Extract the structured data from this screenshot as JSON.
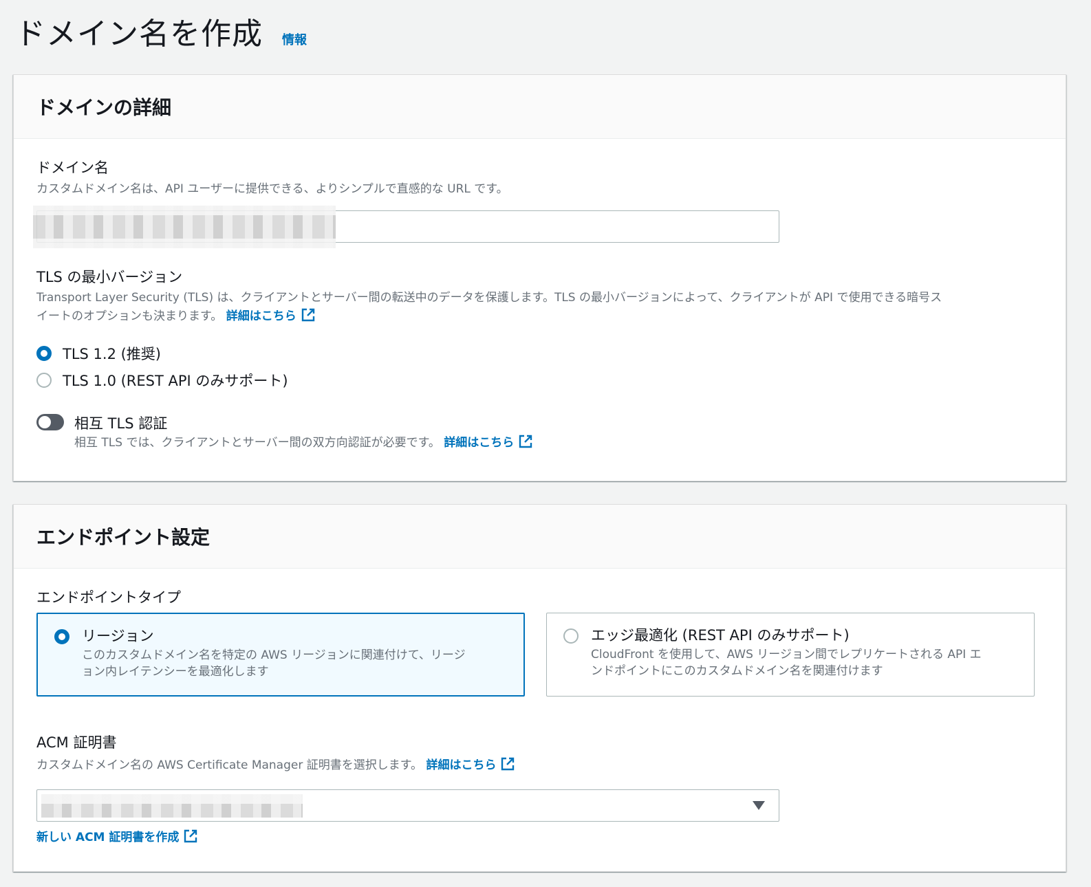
{
  "page": {
    "title": "ドメイン名を作成",
    "info_link": "情報"
  },
  "domain_details": {
    "title": "ドメインの詳細",
    "domain_name": {
      "label": "ドメイン名",
      "description": "カスタムドメイン名は、API ユーザーに提供できる、よりシンプルで直感的な URL です。",
      "value": ""
    },
    "tls": {
      "label": "TLS の最小バージョン",
      "description_line1": "Transport Layer Security (TLS) は、クライアントとサーバー間の転送中のデータを保護します。TLS の最小バージョンによって、クライアントが API で使用できる暗号ス",
      "description_line2": "イートのオプションも決まります。",
      "learn_more": "詳細はこちら",
      "options": [
        {
          "label": "TLS 1.2 (推奨)",
          "selected": true
        },
        {
          "label": "TLS 1.0 (REST API のみサポート)",
          "selected": false
        }
      ]
    },
    "mutual_tls": {
      "label": "相互 TLS 認証",
      "description": "相互 TLS では、クライアントとサーバー間の双方向認証が必要です。",
      "learn_more": "詳細はこちら",
      "enabled": false
    }
  },
  "endpoint": {
    "title": "エンドポイント設定",
    "type_label": "エンドポイントタイプ",
    "tiles": [
      {
        "title": "リージョン",
        "description_line1": "このカスタムドメイン名を特定の AWS リージョンに関連付けて、リージ",
        "description_line2": "ョン内レイテンシーを最適化します",
        "selected": true
      },
      {
        "title": "エッジ最適化 (REST API のみサポート)",
        "description_line1": "CloudFront を使用して、AWS リージョン間でレプリケートされる API エ",
        "description_line2": "ンドポイントにこのカスタムドメイン名を関連付けます",
        "selected": false
      }
    ],
    "acm": {
      "label": "ACM 証明書",
      "description": "カスタムドメイン名の AWS Certificate Manager 証明書を選択します。",
      "learn_more": "詳細はこちら",
      "create_link": "新しい ACM 証明書を作成"
    }
  },
  "colors": {
    "accent": "#0073bb",
    "background": "#f2f3f3",
    "text_secondary": "#687078"
  },
  "icons": {
    "external_link": "external-link-icon",
    "dropdown": "caret-down-icon"
  }
}
